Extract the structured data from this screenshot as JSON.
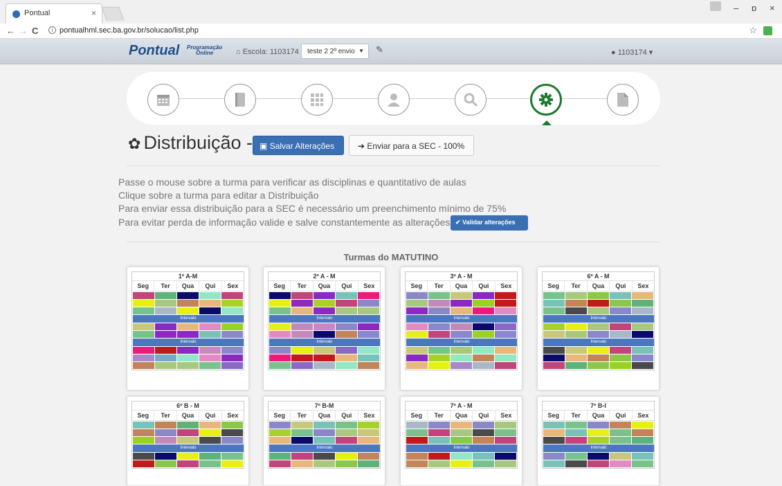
{
  "browser": {
    "tab_title": "Pontual",
    "tab_close": "×",
    "url": "pontualhml.sec.ba.gov.br/solucao/list.php",
    "back": "←",
    "forward": "→",
    "reload": "C",
    "star": "☆",
    "win_min": "–",
    "win_max": "ɒ",
    "win_close": "×"
  },
  "navbar": {
    "brand": "Pontual",
    "brand_sub_1": "Programação",
    "brand_sub_2": "Online",
    "escola_label": "Escola: 1103174",
    "select_value": "teste 2 2º envio",
    "user": "1103174"
  },
  "wizard": {
    "steps": [
      "calendar-icon",
      "book-icon",
      "grid-icon",
      "user-icon",
      "search-icon",
      "gear-icon",
      "document-icon"
    ],
    "active_step": 5,
    "active_color": "#1e7a2e"
  },
  "page": {
    "title": "Distribuição -",
    "save_label": "Salvar Alterações",
    "send_label": "Enviar para a SEC - 100%",
    "info_lines": [
      "Passe o mouse sobre a turma para verificar as disciplinas e quantitativo de aulas",
      "Clique sobre a turma para editar a Distribuição",
      "Para enviar essa distribuição para a SEC é necessário um preenchimento mínimo de 75%",
      "Para evitar perda de informação valide e salve constantemente as alterações"
    ],
    "validar_label": "Validar alterações",
    "section_title": "Turmas do MATUTINO"
  },
  "days": [
    "Seg",
    "Ter",
    "Qua",
    "Qui",
    "Sex"
  ],
  "intervalo_label": "Intervalo",
  "classes": [
    {
      "name": "1º A-M",
      "rows": [
        [
          "#c2447a",
          "#5fb27a",
          "#0a0a6a",
          "#93e8c3",
          "#c2447a"
        ],
        [
          "#e6f012",
          "#a8c87e",
          "#c28458",
          "#e8b77a",
          "#a8d22a"
        ],
        [
          "#78c28c",
          "#a8b8c8",
          "#e6f012",
          "#0a0a6a",
          "#93e8c3"
        ],
        "I",
        [
          "#c8c87a",
          "#8a2ac2",
          "#e8b77a",
          "#e48ac2",
          "#9ad222"
        ],
        [
          "#78c28c",
          "#8a2ac2",
          "#8a2ac2",
          "#78c2b8",
          "#8a88c8"
        ],
        "I",
        [
          "#ee1a7a",
          "#c21a1a",
          "#8a2ac2",
          "#c88ab8",
          "#8a88c8"
        ],
        [
          "#a888c8",
          "#78a8c8",
          "#93e8c3",
          "#e48ac2",
          "#8a2ac2"
        ],
        [
          "#c28458",
          "#a8c87e",
          "#a8c87e",
          "#78c28c",
          "#8a68c8"
        ]
      ]
    },
    {
      "name": "2º A - M",
      "rows": [
        [
          "#0a0a6a",
          "#c2447a",
          "#8a2ac2",
          "#78c2b8",
          "#ee1a7a"
        ],
        [
          "#e6f012",
          "#8a2ac2",
          "#a8d22a",
          "#c2447a",
          "#8a88c8"
        ],
        [
          "#78c28c",
          "#e8b77a",
          "#8a2ac2",
          "#a8c87e",
          "#a8c87e"
        ],
        "I",
        [
          "#e6f012",
          "#c28ab8",
          "#c888c8",
          "#8a88c8",
          "#8a2ac2"
        ],
        [
          "#e48ac2",
          "#c28ab8",
          "#0a0a6a",
          "#c28458",
          "#8a88c8"
        ],
        "I",
        [
          "#8a88c8",
          "#e6f012",
          "#c8c87a",
          "#8a68c8",
          "#93e8c3"
        ],
        [
          "#ee1a7a",
          "#c21a1a",
          "#c21a1a",
          "#e8b77a",
          "#78c2b8"
        ],
        [
          "#78c28c",
          "#8a68c8",
          "#a8b8c8",
          "#93e8c3",
          "#c28458"
        ]
      ]
    },
    {
      "name": "3º A - M",
      "rows": [
        [
          "#8a88c8",
          "#78c28c",
          "#c8c87a",
          "#8a2ac2",
          "#c21a1a"
        ],
        [
          "#a8c87e",
          "#c28ab8",
          "#8a2ac2",
          "#9ad222",
          "#c21a1a"
        ],
        [
          "#8a2ac2",
          "#8a88c8",
          "#e8b77a",
          "#ee1a7a",
          "#e48ac2"
        ],
        "I",
        [
          "#e48ac2",
          "#8a88c8",
          "#c28ab8",
          "#0a0a6a",
          "#8a68c8"
        ],
        [
          "#e6f012",
          "#c2447a",
          "#8a88c8",
          "#9ad222",
          "#8a88c8"
        ],
        "I",
        [
          "#c8c87a",
          "#78c28c",
          "#a8c87e",
          "#93e8c3",
          "#e8b77a"
        ],
        [
          "#8a2ac2",
          "#a8d22a",
          "#93e8c3",
          "#c28458",
          "#93e8c3"
        ],
        [
          "#e8b77a",
          "#e6f012",
          "#a888c8",
          "#a8b8c8",
          "#c2447a"
        ]
      ]
    },
    {
      "name": "6º A - M",
      "rows": [
        [
          "#78c28c",
          "#a8c87e",
          "#8ac84a",
          "#78c2b8",
          "#e8b77a"
        ],
        [
          "#78c2b8",
          "#c28458",
          "#c21a1a",
          "#8ac84a",
          "#5fb27a"
        ],
        [
          "#78c28c",
          "#4a4a4a",
          "#a8c87e",
          "#8a88c8",
          "#a8b8c8"
        ],
        "I",
        [
          "#a8d22a",
          "#e6f012",
          "#a8c87e",
          "#c2447a",
          "#a8c87e"
        ],
        [
          "#c8c87a",
          "#a8c87e",
          "#8a88c8",
          "#a8b8c8",
          "#0a0a6a"
        ],
        "I",
        [
          "#4a4a4a",
          "#c8c87a",
          "#e6f012",
          "#c2447a",
          "#78c2b8"
        ],
        [
          "#0a0a6a",
          "#e8b77a",
          "#c28458",
          "#8ac84a",
          "#8a88c8"
        ],
        [
          "#c2447a",
          "#5fb27a",
          "#8ac84a",
          "#9ad222",
          "#4a4a4a"
        ]
      ]
    },
    {
      "name": "6º B - M",
      "rows": [
        [
          "#78c2b8",
          "#c28458",
          "#5fb27a",
          "#e8b77a",
          "#8ac84a"
        ],
        [
          "#c28458",
          "#8a88c8",
          "#c2447a",
          "#e6f012",
          "#4a4a4a"
        ],
        [
          "#9ad222",
          "#c28ab8",
          "#c8c87a",
          "#4a4a4a",
          "#8a88c8"
        ],
        "I",
        [
          "#4a4a4a",
          "#0a0a6a",
          "#e6f012",
          "#5fb27a",
          "#78c28c"
        ],
        [
          "#c21a1a",
          "#8ac84a",
          "#c2447a",
          "#78c28c",
          "#e6f012"
        ]
      ]
    },
    {
      "name": "7º B-M",
      "rows": [
        [
          "#8a88c8",
          "#c8c87a",
          "#78c2b8",
          "#78c28c",
          "#a8d22a"
        ],
        [
          "#a8d22a",
          "#78c28c",
          "#8a88c8",
          "#a8c87e",
          "#c8c87a"
        ],
        [
          "#e8b77a",
          "#0a0a6a",
          "#78c2b8",
          "#c2447a",
          "#e8b77a"
        ],
        "I",
        [
          "#5fb27a",
          "#c2447a",
          "#4a4a4a",
          "#e6f012",
          "#c28458"
        ],
        [
          "#c2447a",
          "#e8b77a",
          "#a8c87e",
          "#8ac84a",
          "#5fb27a"
        ]
      ]
    },
    {
      "name": "7º A - M",
      "rows": [
        [
          "#a8b8c8",
          "#8a88c8",
          "#e8b77a",
          "#8a88c8",
          "#a8c87e"
        ],
        [
          "#78c28c",
          "#c2447a",
          "#a8c87e",
          "#4a4a4a",
          "#78c28c"
        ],
        [
          "#c21a1a",
          "#78c2b8",
          "#8ac84a",
          "#c28458",
          "#c2447a"
        ],
        "I",
        [
          "#c28458",
          "#c21a1a",
          "#93e8c3",
          "#78c2b8",
          "#0a0a6a"
        ],
        [
          "#c28458",
          "#a8c87e",
          "#e6f012",
          "#78c28c",
          "#a8c87e"
        ]
      ]
    },
    {
      "name": "7º B-I",
      "rows": [
        [
          "#78c2b8",
          "#78c28c",
          "#8a88c8",
          "#c28458",
          "#e6f012"
        ],
        [
          "#e8b77a",
          "#78c2b8",
          "#e6f012",
          "#78c28c",
          "#c28458"
        ],
        [
          "#4a4a4a",
          "#c2447a",
          "#a8d22a",
          "#78c28c",
          "#5fb27a"
        ],
        "I",
        [
          "#8a88c8",
          "#78c28c",
          "#0a0a6a",
          "#c8c87a",
          "#78c2b8"
        ],
        [
          "#78c2b8",
          "#4a4a4a",
          "#c2447a",
          "#e48ac2",
          "#78c28c"
        ]
      ]
    }
  ]
}
